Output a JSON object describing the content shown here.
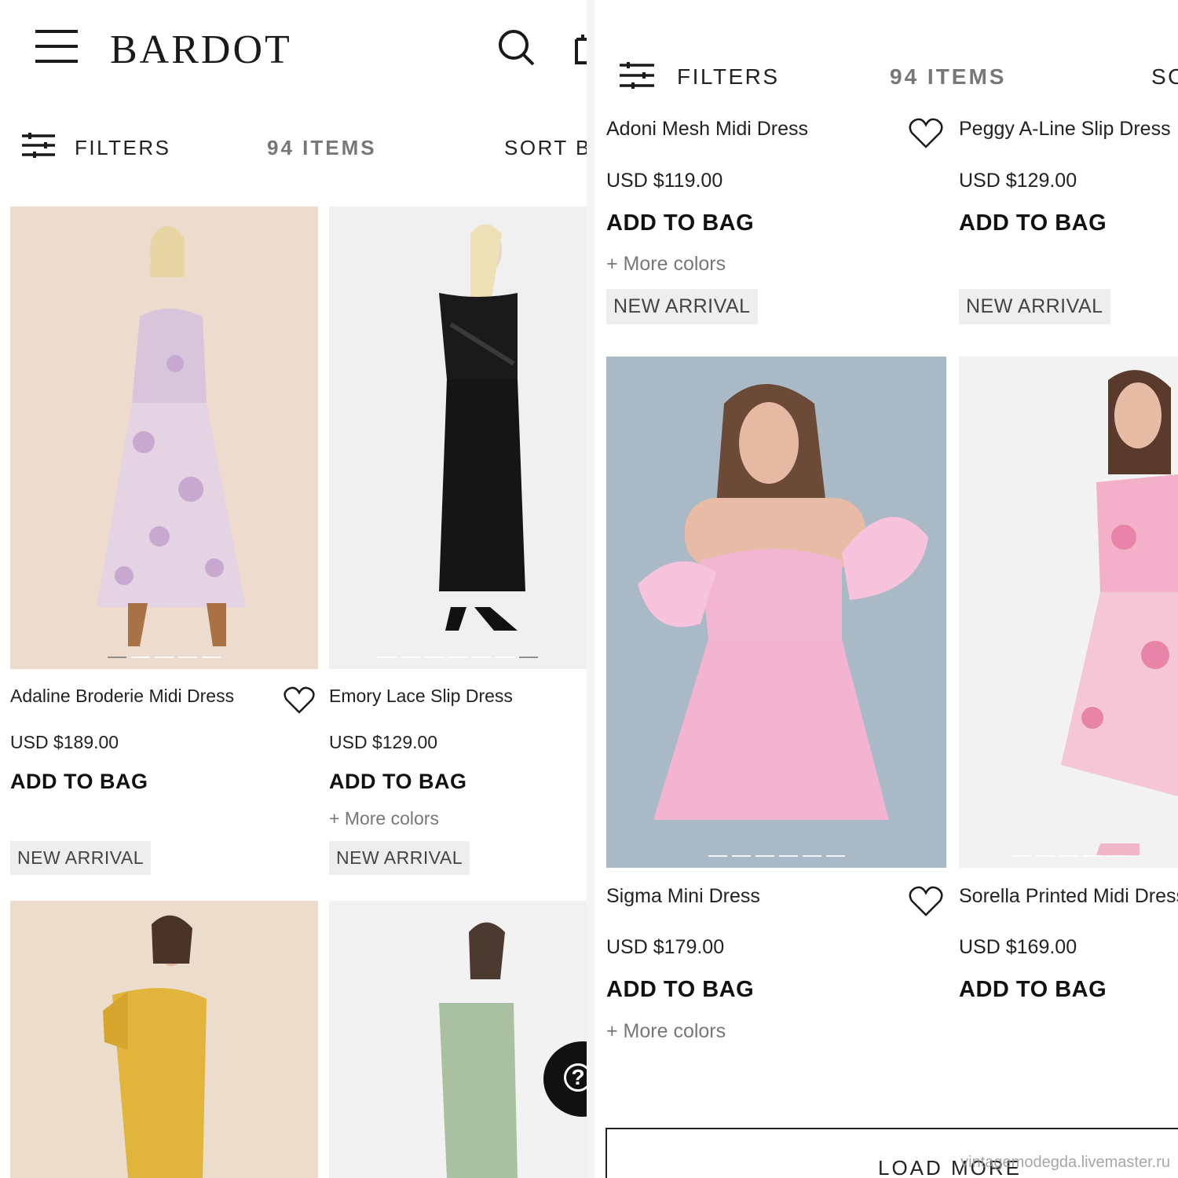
{
  "left": {
    "brand": "BARDOT",
    "toolbar": {
      "filters": "FILTERS",
      "count": "94 ITEMS",
      "sort": "SORT BY"
    },
    "products": [
      {
        "name": "Adaline Broderie Midi Dress",
        "price": "USD $189.00",
        "cta": "ADD TO BAG",
        "more": "",
        "badge": "NEW ARRIVAL"
      },
      {
        "name": "Emory Lace Slip Dress",
        "price": "USD $129.00",
        "cta": "ADD TO BAG",
        "more": "+ More colors",
        "badge": "NEW ARRIVAL"
      }
    ],
    "help": "?"
  },
  "right": {
    "toolbar": {
      "filters": "FILTERS",
      "count": "94 ITEMS",
      "sort": "SORT BY"
    },
    "products": [
      {
        "name": "Adoni Mesh Midi Dress",
        "price": "USD $119.00",
        "cta": "ADD TO BAG",
        "more": "+ More colors",
        "badge": "NEW ARRIVAL"
      },
      {
        "name": "Peggy A-Line Slip Dress",
        "price": "USD $129.00",
        "cta": "ADD TO BAG",
        "more": "",
        "badge": "NEW ARRIVAL"
      },
      {
        "name": "Sigma Mini Dress",
        "price": "USD $179.00",
        "cta": "ADD TO BAG",
        "more": "+ More colors",
        "badge": ""
      },
      {
        "name": "Sorella Printed Midi Dress",
        "price": "USD $169.00",
        "cta": "ADD TO BAG",
        "more": "",
        "badge": ""
      }
    ],
    "load_more": "LOAD MORE"
  },
  "watermark": "vintagemodegda.livemaster.ru",
  "icons": [
    "menu-icon",
    "search-icon",
    "bag-icon",
    "filter-icon",
    "heart-icon",
    "help-icon"
  ],
  "colors": {
    "text": "#1a1a1a",
    "muted": "#777777",
    "badge_bg": "#eeeeee"
  }
}
